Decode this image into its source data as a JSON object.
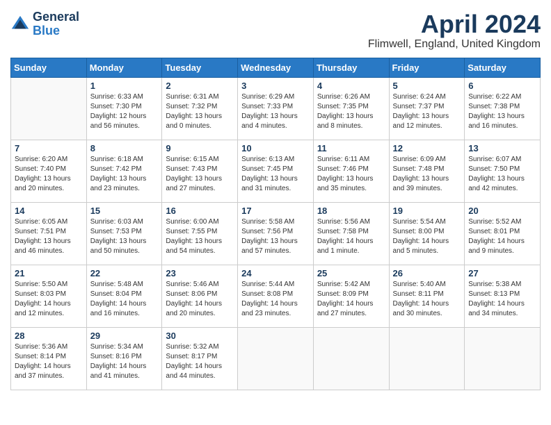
{
  "header": {
    "logo_line1": "General",
    "logo_line2": "Blue",
    "month_title": "April 2024",
    "location": "Flimwell, England, United Kingdom"
  },
  "weekdays": [
    "Sunday",
    "Monday",
    "Tuesday",
    "Wednesday",
    "Thursday",
    "Friday",
    "Saturday"
  ],
  "weeks": [
    [
      {
        "day": "",
        "sunrise": "",
        "sunset": "",
        "daylight": ""
      },
      {
        "day": "1",
        "sunrise": "Sunrise: 6:33 AM",
        "sunset": "Sunset: 7:30 PM",
        "daylight": "Daylight: 12 hours and 56 minutes."
      },
      {
        "day": "2",
        "sunrise": "Sunrise: 6:31 AM",
        "sunset": "Sunset: 7:32 PM",
        "daylight": "Daylight: 13 hours and 0 minutes."
      },
      {
        "day": "3",
        "sunrise": "Sunrise: 6:29 AM",
        "sunset": "Sunset: 7:33 PM",
        "daylight": "Daylight: 13 hours and 4 minutes."
      },
      {
        "day": "4",
        "sunrise": "Sunrise: 6:26 AM",
        "sunset": "Sunset: 7:35 PM",
        "daylight": "Daylight: 13 hours and 8 minutes."
      },
      {
        "day": "5",
        "sunrise": "Sunrise: 6:24 AM",
        "sunset": "Sunset: 7:37 PM",
        "daylight": "Daylight: 13 hours and 12 minutes."
      },
      {
        "day": "6",
        "sunrise": "Sunrise: 6:22 AM",
        "sunset": "Sunset: 7:38 PM",
        "daylight": "Daylight: 13 hours and 16 minutes."
      }
    ],
    [
      {
        "day": "7",
        "sunrise": "Sunrise: 6:20 AM",
        "sunset": "Sunset: 7:40 PM",
        "daylight": "Daylight: 13 hours and 20 minutes."
      },
      {
        "day": "8",
        "sunrise": "Sunrise: 6:18 AM",
        "sunset": "Sunset: 7:42 PM",
        "daylight": "Daylight: 13 hours and 23 minutes."
      },
      {
        "day": "9",
        "sunrise": "Sunrise: 6:15 AM",
        "sunset": "Sunset: 7:43 PM",
        "daylight": "Daylight: 13 hours and 27 minutes."
      },
      {
        "day": "10",
        "sunrise": "Sunrise: 6:13 AM",
        "sunset": "Sunset: 7:45 PM",
        "daylight": "Daylight: 13 hours and 31 minutes."
      },
      {
        "day": "11",
        "sunrise": "Sunrise: 6:11 AM",
        "sunset": "Sunset: 7:46 PM",
        "daylight": "Daylight: 13 hours and 35 minutes."
      },
      {
        "day": "12",
        "sunrise": "Sunrise: 6:09 AM",
        "sunset": "Sunset: 7:48 PM",
        "daylight": "Daylight: 13 hours and 39 minutes."
      },
      {
        "day": "13",
        "sunrise": "Sunrise: 6:07 AM",
        "sunset": "Sunset: 7:50 PM",
        "daylight": "Daylight: 13 hours and 42 minutes."
      }
    ],
    [
      {
        "day": "14",
        "sunrise": "Sunrise: 6:05 AM",
        "sunset": "Sunset: 7:51 PM",
        "daylight": "Daylight: 13 hours and 46 minutes."
      },
      {
        "day": "15",
        "sunrise": "Sunrise: 6:03 AM",
        "sunset": "Sunset: 7:53 PM",
        "daylight": "Daylight: 13 hours and 50 minutes."
      },
      {
        "day": "16",
        "sunrise": "Sunrise: 6:00 AM",
        "sunset": "Sunset: 7:55 PM",
        "daylight": "Daylight: 13 hours and 54 minutes."
      },
      {
        "day": "17",
        "sunrise": "Sunrise: 5:58 AM",
        "sunset": "Sunset: 7:56 PM",
        "daylight": "Daylight: 13 hours and 57 minutes."
      },
      {
        "day": "18",
        "sunrise": "Sunrise: 5:56 AM",
        "sunset": "Sunset: 7:58 PM",
        "daylight": "Daylight: 14 hours and 1 minute."
      },
      {
        "day": "19",
        "sunrise": "Sunrise: 5:54 AM",
        "sunset": "Sunset: 8:00 PM",
        "daylight": "Daylight: 14 hours and 5 minutes."
      },
      {
        "day": "20",
        "sunrise": "Sunrise: 5:52 AM",
        "sunset": "Sunset: 8:01 PM",
        "daylight": "Daylight: 14 hours and 9 minutes."
      }
    ],
    [
      {
        "day": "21",
        "sunrise": "Sunrise: 5:50 AM",
        "sunset": "Sunset: 8:03 PM",
        "daylight": "Daylight: 14 hours and 12 minutes."
      },
      {
        "day": "22",
        "sunrise": "Sunrise: 5:48 AM",
        "sunset": "Sunset: 8:04 PM",
        "daylight": "Daylight: 14 hours and 16 minutes."
      },
      {
        "day": "23",
        "sunrise": "Sunrise: 5:46 AM",
        "sunset": "Sunset: 8:06 PM",
        "daylight": "Daylight: 14 hours and 20 minutes."
      },
      {
        "day": "24",
        "sunrise": "Sunrise: 5:44 AM",
        "sunset": "Sunset: 8:08 PM",
        "daylight": "Daylight: 14 hours and 23 minutes."
      },
      {
        "day": "25",
        "sunrise": "Sunrise: 5:42 AM",
        "sunset": "Sunset: 8:09 PM",
        "daylight": "Daylight: 14 hours and 27 minutes."
      },
      {
        "day": "26",
        "sunrise": "Sunrise: 5:40 AM",
        "sunset": "Sunset: 8:11 PM",
        "daylight": "Daylight: 14 hours and 30 minutes."
      },
      {
        "day": "27",
        "sunrise": "Sunrise: 5:38 AM",
        "sunset": "Sunset: 8:13 PM",
        "daylight": "Daylight: 14 hours and 34 minutes."
      }
    ],
    [
      {
        "day": "28",
        "sunrise": "Sunrise: 5:36 AM",
        "sunset": "Sunset: 8:14 PM",
        "daylight": "Daylight: 14 hours and 37 minutes."
      },
      {
        "day": "29",
        "sunrise": "Sunrise: 5:34 AM",
        "sunset": "Sunset: 8:16 PM",
        "daylight": "Daylight: 14 hours and 41 minutes."
      },
      {
        "day": "30",
        "sunrise": "Sunrise: 5:32 AM",
        "sunset": "Sunset: 8:17 PM",
        "daylight": "Daylight: 14 hours and 44 minutes."
      },
      {
        "day": "",
        "sunrise": "",
        "sunset": "",
        "daylight": ""
      },
      {
        "day": "",
        "sunrise": "",
        "sunset": "",
        "daylight": ""
      },
      {
        "day": "",
        "sunrise": "",
        "sunset": "",
        "daylight": ""
      },
      {
        "day": "",
        "sunrise": "",
        "sunset": "",
        "daylight": ""
      }
    ]
  ]
}
